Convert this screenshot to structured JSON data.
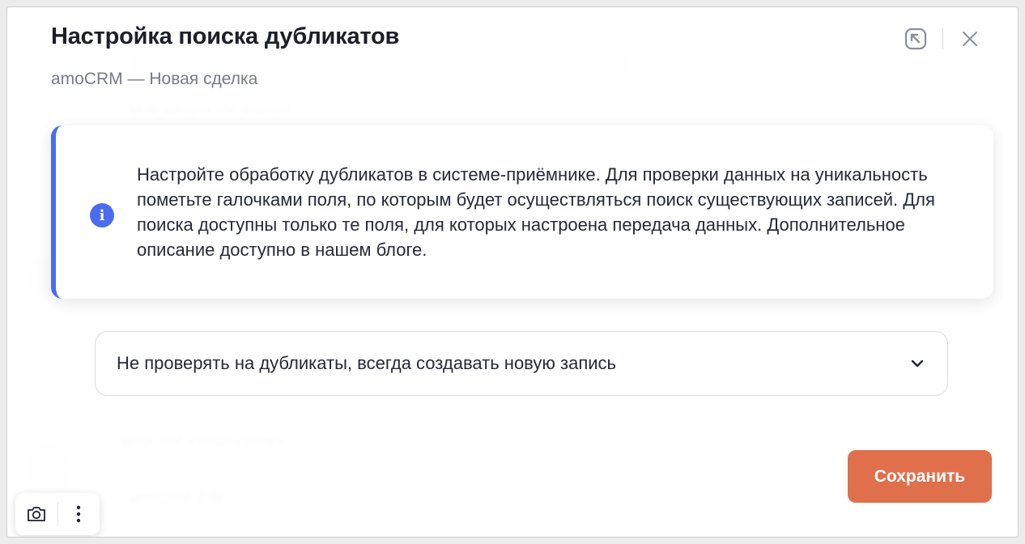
{
  "modal": {
    "title": "Настройка поиска дубликатов",
    "subtitle": "amoCRM — Новая сделка",
    "info_text": "Настройте обработку дубликатов в системе-приёмнике. Для проверки данных на уникальность пометьте галочками поля, по которым будет осуществляться поиск существующих записей. Для поиска доступны только те поля, для которых настроена передача данных. Дополнительное описание доступно в нашем блоге.",
    "info_icon_glyph": "i",
    "duplicate_mode": {
      "selected": "Не проверять на дубликаты, всегда создавать новую запись"
    },
    "save_label": "Сохранить"
  },
  "background": {
    "texts": [
      "Мой аккаунт UK Wanted",
      "amoCRM: Новая сделка",
      "amoCRM: Edit"
    ]
  },
  "icons": {
    "collapse": "collapse-arrow-icon",
    "close": "close-icon",
    "info": "info-icon",
    "chevron": "chevron-down-icon",
    "screenshot": "screenshot-camera-icon",
    "more": "more-vertical-icon"
  },
  "colors": {
    "accent_blue": "#4a6cf0",
    "save_button": "#e0704b",
    "title_text": "#1c1e29",
    "subtitle_text": "#757a8a"
  }
}
